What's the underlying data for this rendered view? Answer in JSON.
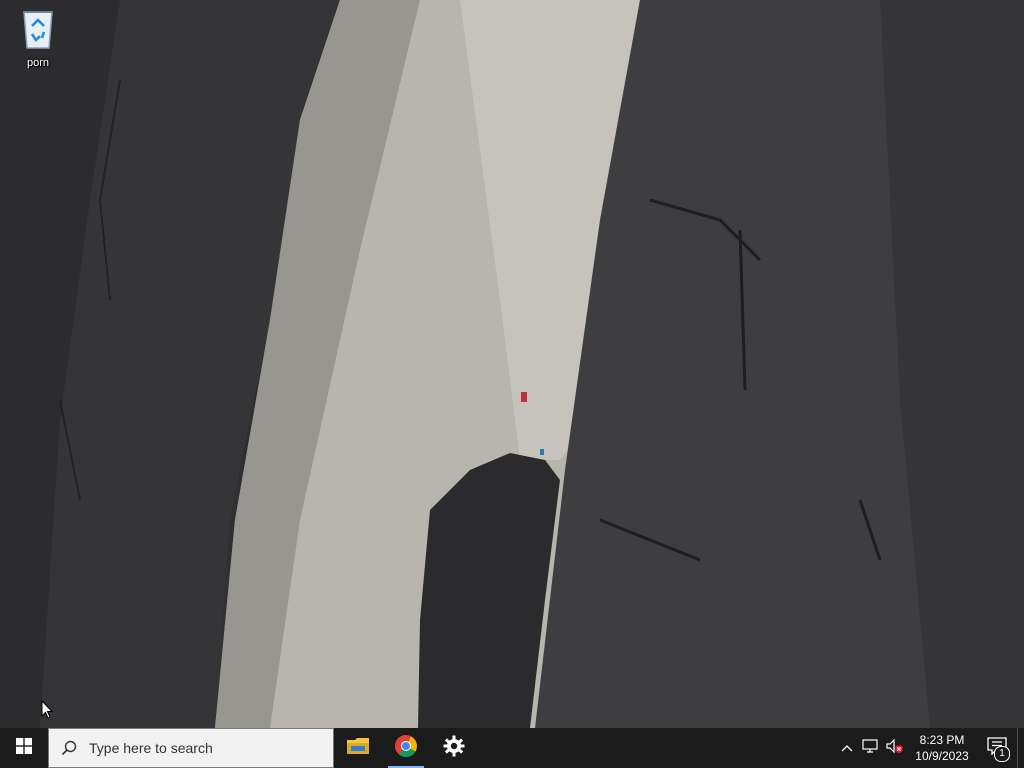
{
  "desktop": {
    "wallpaper": "granite-cliff-climber",
    "icons": [
      {
        "label": "porn",
        "icon": "recycle-bin-icon"
      }
    ]
  },
  "taskbar": {
    "search": {
      "placeholder": "Type here to search"
    },
    "apps": [
      {
        "name": "File Explorer",
        "icon": "file-explorer-icon",
        "running": false
      },
      {
        "name": "Google Chrome",
        "icon": "chrome-icon",
        "running": true
      },
      {
        "name": "Settings",
        "icon": "settings-icon",
        "running": false
      }
    ],
    "tray": {
      "time": "8:23 PM",
      "date": "10/9/2023",
      "notification_count": "1"
    }
  },
  "colors": {
    "taskbar_bg": "#1b1b1c",
    "search_bg": "#f2f2f2",
    "accent": "#0078d7"
  }
}
